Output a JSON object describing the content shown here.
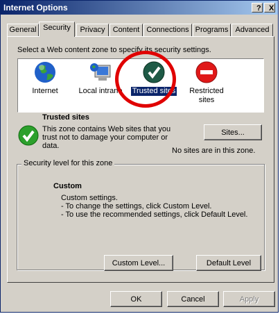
{
  "window": {
    "title": "Internet Options",
    "help_button": "?",
    "close_button": "X"
  },
  "tabs": [
    {
      "label": "General"
    },
    {
      "label": "Security"
    },
    {
      "label": "Privacy"
    },
    {
      "label": "Content"
    },
    {
      "label": "Connections"
    },
    {
      "label": "Programs"
    },
    {
      "label": "Advanced"
    }
  ],
  "active_tab": "Security",
  "security": {
    "instruction": "Select a Web content zone to specify its security settings.",
    "zones": [
      {
        "label": "Internet",
        "icon": "globe-icon"
      },
      {
        "label": "Local intrane",
        "icon": "computer-icon"
      },
      {
        "label": "Trusted sites",
        "icon": "checkmark-icon",
        "selected": true
      },
      {
        "label": "Restricted sites",
        "icon": "no-entry-icon"
      }
    ],
    "zone_info": {
      "title": "Trusted sites",
      "description": "This zone contains Web sites that you trust not to damage your computer or data.",
      "sites_button": "Sites...",
      "sites_status": "No sites are in this zone."
    },
    "level": {
      "legend": "Security level for this zone",
      "name": "Custom",
      "line1": "Custom settings.",
      "line2": "- To change the settings, click Custom Level.",
      "line3": "- To use the recommended settings, click Default Level.",
      "custom_level_button": "Custom Level...",
      "default_level_button": "Default Level"
    }
  },
  "footer": {
    "ok_label": "OK",
    "cancel_label": "Cancel",
    "apply_label": "Apply"
  },
  "colors": {
    "title_bar": "#0a246a",
    "face": "#d4d0c8",
    "annotation_circle": "#e00000"
  }
}
